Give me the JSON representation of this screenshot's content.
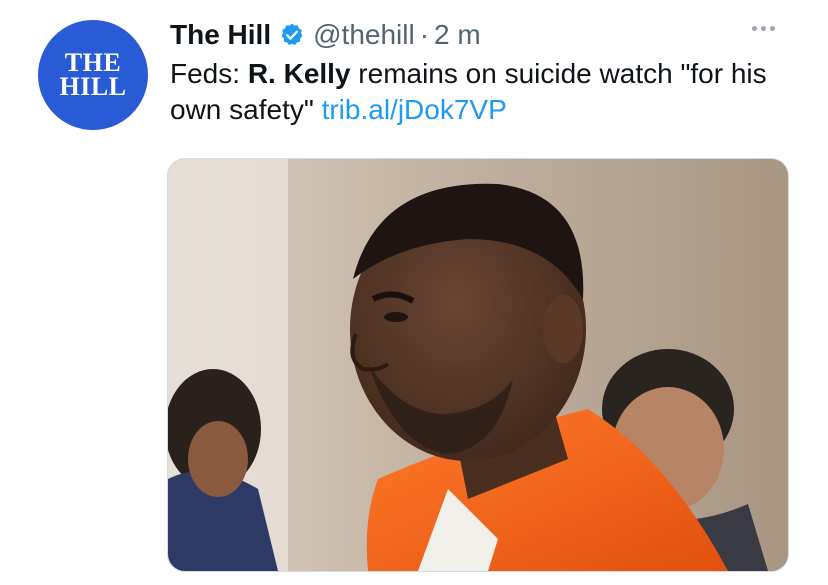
{
  "tweet": {
    "author": {
      "avatar_line1": "THE",
      "avatar_line2": "HILL",
      "name": "The Hill",
      "handle": "@thehill",
      "separator": "·",
      "time": "2 m"
    },
    "text": {
      "prefix": "Feds: ",
      "bold": "R. Kelly",
      "middle": " remains on suicide watch \"for his own safety\" ",
      "link": "trib.al/jDok7VP"
    },
    "media": {
      "description_icon": "photo"
    },
    "colors": {
      "avatar_bg": "#2a5bd7",
      "link": "#1d9bf0",
      "verified": "#1d9bf0",
      "muted": "#536471"
    },
    "icons": {
      "verified": "verified-badge-icon",
      "more": "more-options-icon"
    }
  }
}
